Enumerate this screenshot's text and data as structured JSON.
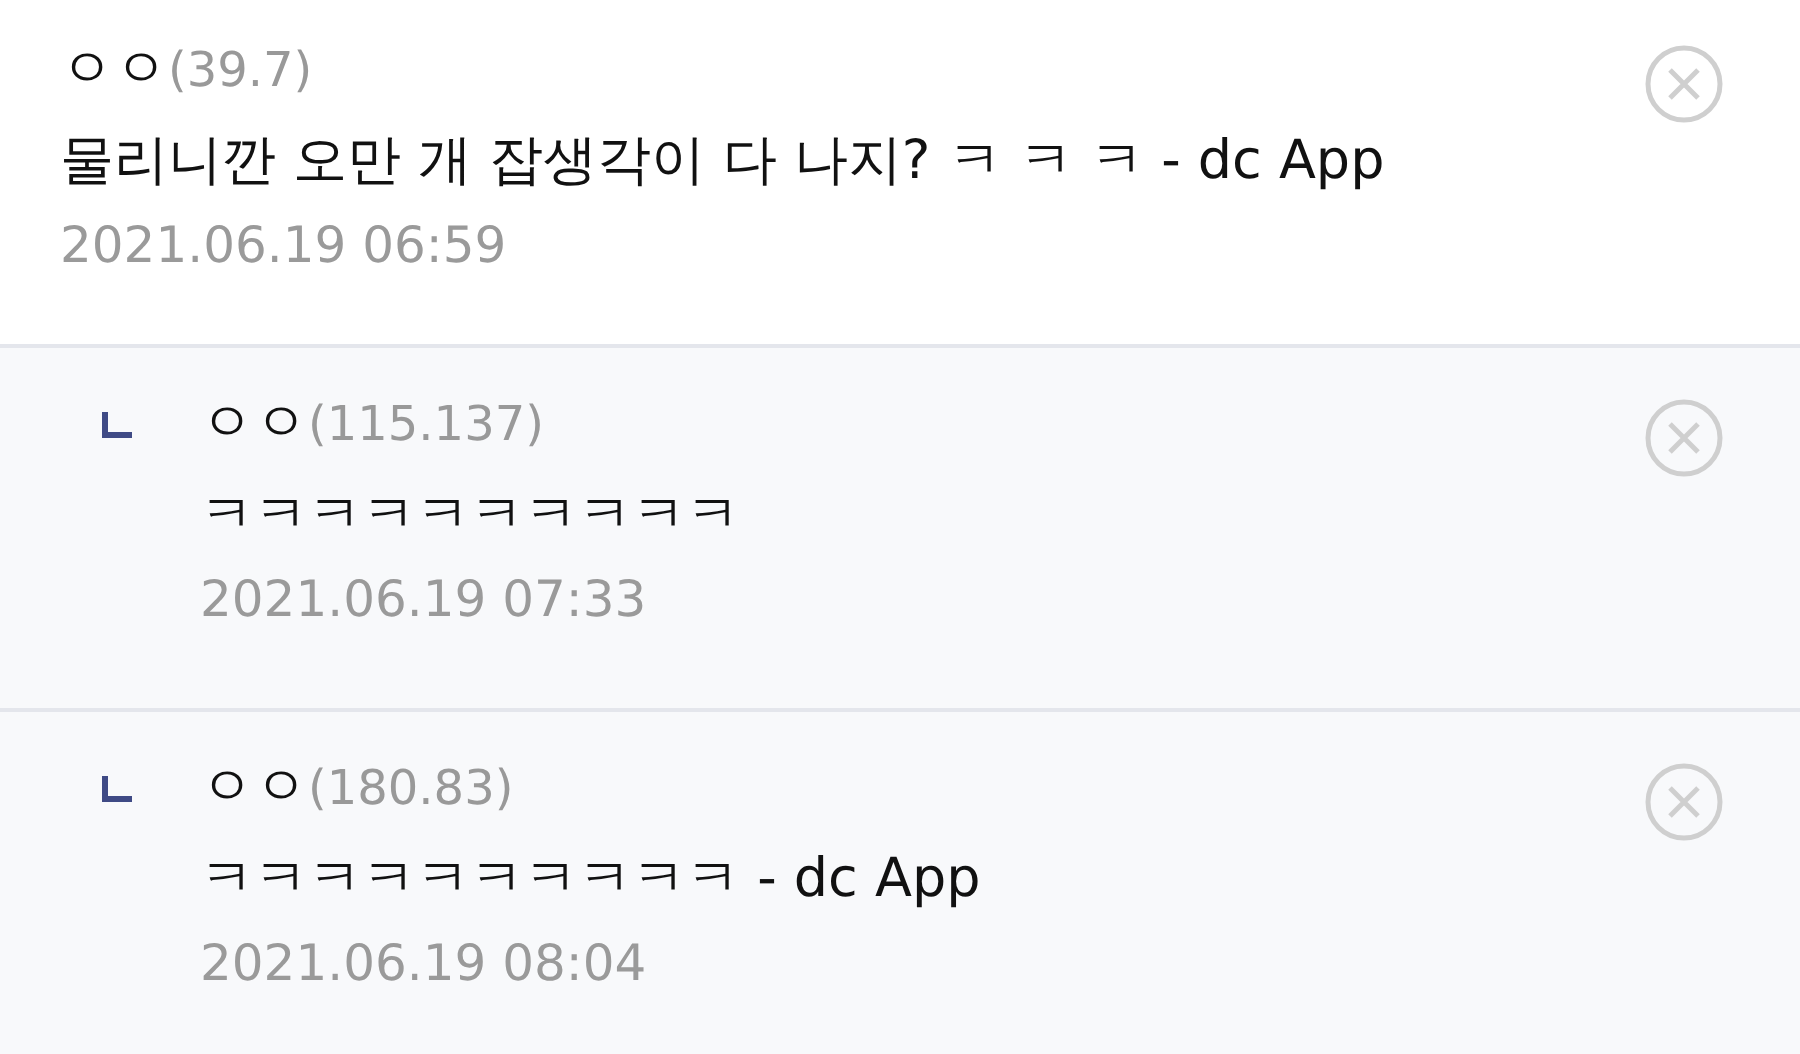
{
  "comments": [
    {
      "author": "ㅇㅇ",
      "ip": "(39.7)",
      "text": "물리니깐 오만 개 잡생각이 다 나지? ㅋ ㅋ ㅋ - dc App",
      "date": "2021.06.19 06:59",
      "children": [
        {
          "author": "ㅇㅇ",
          "ip": "(115.137)",
          "text": "ㅋㅋㅋㅋㅋㅋㅋㅋㅋㅋ",
          "date": "2021.06.19 07:33"
        },
        {
          "author": "ㅇㅇ",
          "ip": "(180.83)",
          "text": "ㅋㅋㅋㅋㅋㅋㅋㅋㅋㅋ - dc App",
          "date": "2021.06.19 08:04"
        }
      ]
    }
  ]
}
